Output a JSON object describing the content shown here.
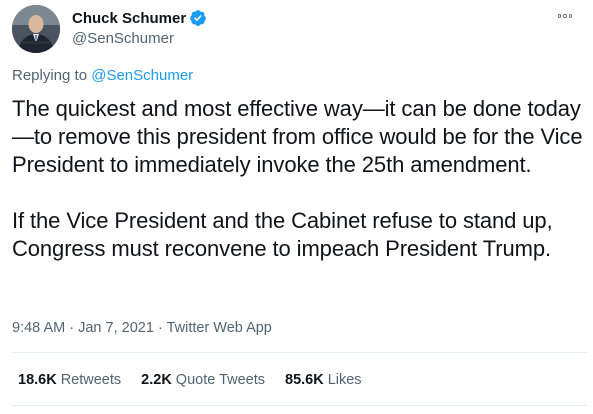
{
  "author": {
    "name": "Chuck Schumer",
    "handle": "@SenSchumer",
    "verified": true
  },
  "replying": {
    "prefix": "Replying to",
    "to": "@SenSchumer"
  },
  "tweet": {
    "paragraph1": "The quickest and most effective way—it can be done today—to remove this president from office would be for the Vice President to immediately invoke the 25th amendment.",
    "paragraph2": "If the Vice President and the Cabinet refuse to stand up, Congress must reconvene to impeach President Trump."
  },
  "meta": {
    "time": "9:48 AM",
    "sep1": "·",
    "date": "Jan 7, 2021",
    "sep2": "·",
    "app": "Twitter Web App"
  },
  "stats": {
    "retweets": {
      "count": "18.6K",
      "label": "Retweets"
    },
    "quotes": {
      "count": "2.2K",
      "label": "Quote Tweets"
    },
    "likes": {
      "count": "85.6K",
      "label": "Likes"
    }
  },
  "colors": {
    "accent": "#1d9bf0",
    "text": "#0f1419",
    "secondary": "#536471",
    "divider": "#e6ecf0"
  },
  "icons": {
    "verified": "verified-badge-icon",
    "more": "more-horizontal-icon"
  }
}
